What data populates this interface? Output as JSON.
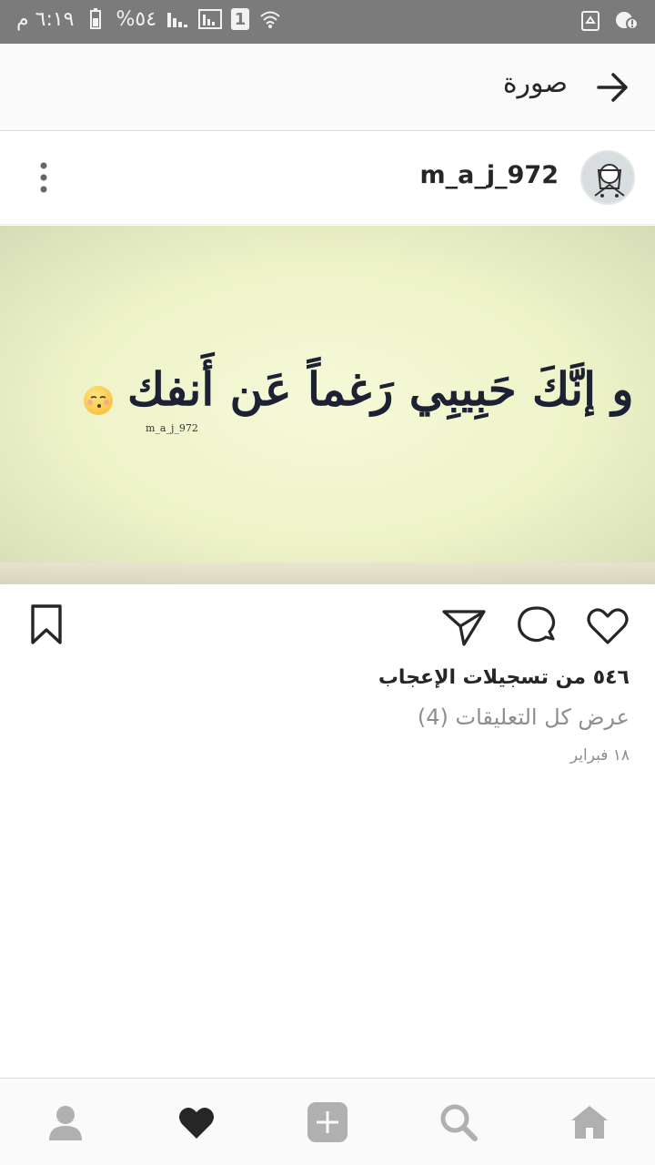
{
  "status_bar": {
    "time": "٦:١٩ م",
    "battery": "%٥٤",
    "sim_badge": "1"
  },
  "app_bar": {
    "title": "صورة"
  },
  "post": {
    "username": "m_a_j_972",
    "image_text": "و إنَّكَ حَبِيبِي رَغماً عَن أَنفك",
    "watermark": "m_a_j_972",
    "likes_text": "٥٤٦ من تسجيلات الإعجاب",
    "comments_link": "عرض كل التعليقات (4)",
    "date": "١٨ فبراير"
  },
  "icons": {
    "back": "arrow-right-icon",
    "more": "more-vertical-icon",
    "like": "heart-icon",
    "comment": "comment-icon",
    "share": "send-icon",
    "save": "bookmark-icon",
    "nav": [
      "profile-icon",
      "activity-heart-icon",
      "add-post-icon",
      "search-icon",
      "home-icon"
    ]
  },
  "colors": {
    "status_bar": "#7b7b7b",
    "text": "#262626",
    "secondary": "#8e8e8e",
    "nav_icon": "#b0b0b0"
  }
}
